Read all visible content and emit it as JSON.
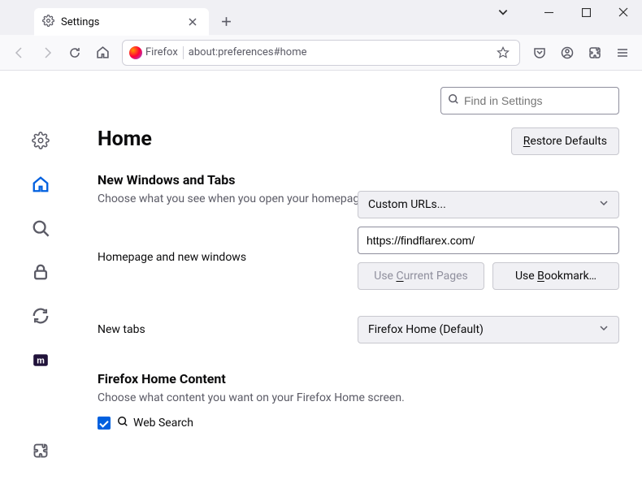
{
  "window": {
    "tab_title": "Settings",
    "close": "×",
    "minimize": "—",
    "maximize": "☐"
  },
  "toolbar": {
    "identity_label": "Firefox",
    "url": "about:preferences#home"
  },
  "find": {
    "placeholder": "Find in Settings"
  },
  "page": {
    "title": "Home",
    "restore_label": "Restore Defaults"
  },
  "section_new_windows": {
    "title": "New Windows and Tabs",
    "desc": "Choose what you see when you open your homepage, new windows, and new tabs.",
    "homepage_label": "Homepage and new windows",
    "homepage_select": "Custom URLs...",
    "homepage_url": "https://findflarex.com/",
    "use_current": "Use Current Pages",
    "use_bookmark": "Use Bookmark…",
    "newtabs_label": "New tabs",
    "newtabs_select": "Firefox Home (Default)"
  },
  "section_home_content": {
    "title": "Firefox Home Content",
    "desc": "Choose what content you want on your Firefox Home screen.",
    "websearch_label": "Web Search"
  }
}
